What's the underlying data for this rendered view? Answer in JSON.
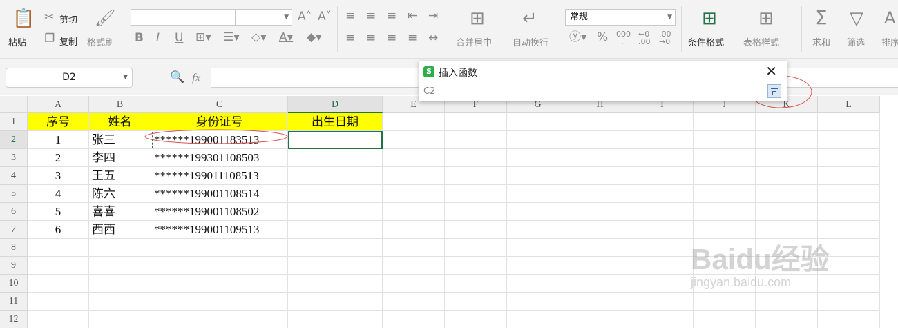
{
  "ribbon": {
    "clipboard": {
      "paste": "粘贴",
      "cut": "剪切",
      "copy": "复制",
      "format_painter": "格式刷"
    },
    "font": {
      "name_value": "",
      "size_value": ""
    },
    "alignment": {
      "merge_center": "合并居中",
      "wrap_text": "自动换行"
    },
    "number": {
      "format_value": "常规"
    },
    "styles": {
      "conditional_format": "条件格式",
      "table_style": "表格样式"
    },
    "editing": {
      "sum": "求和",
      "filter": "筛选",
      "sort": "排序"
    }
  },
  "formula_bar": {
    "name_box": "D2",
    "fx_label": "fx",
    "formula_value": ""
  },
  "columns": [
    "A",
    "B",
    "C",
    "D",
    "E",
    "F",
    "G",
    "H",
    "I",
    "J",
    "K",
    "L"
  ],
  "selected_column": "D",
  "rows": [
    "1",
    "2",
    "3",
    "4",
    "5",
    "6",
    "7",
    "8",
    "9",
    "10",
    "11",
    "12"
  ],
  "selected_row": "2",
  "table": {
    "headers": [
      "序号",
      "姓名",
      "身份证号",
      "出生日期"
    ],
    "data": [
      [
        "1",
        "张三",
        "******199001183513",
        ""
      ],
      [
        "2",
        "李四",
        "******199301108503",
        ""
      ],
      [
        "3",
        "王五",
        "******199011108513",
        ""
      ],
      [
        "4",
        "陈六",
        "******199001108514",
        ""
      ],
      [
        "5",
        "喜喜",
        "******199001108502",
        ""
      ],
      [
        "6",
        "西西",
        "******199001109513",
        ""
      ]
    ]
  },
  "dialog": {
    "title": "插入函数",
    "reference": "C2",
    "close_icon": "close-icon",
    "collapse_icon": "range-select-icon"
  },
  "watermark": {
    "brand": "Baidu经验",
    "url": "jingyan.baidu.com"
  },
  "colors": {
    "header_fill": "#ffff00",
    "selection_green": "#217346",
    "annotation_red": "#d9534f"
  }
}
